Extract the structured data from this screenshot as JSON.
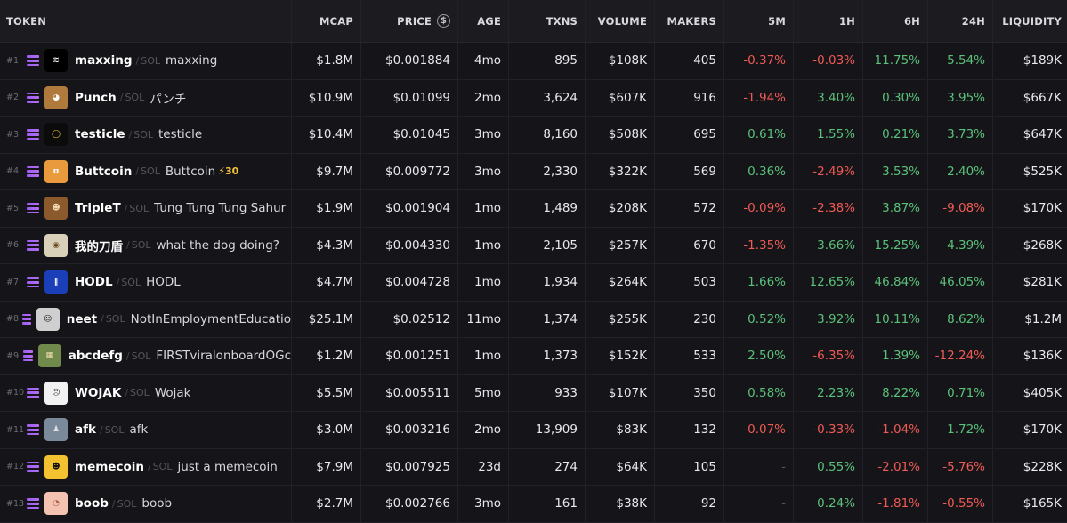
{
  "headers": {
    "token": "TOKEN",
    "mcap": "MCAP",
    "price": "PRICE",
    "price_icon": "$",
    "age": "AGE",
    "txns": "TXNS",
    "volume": "VOLUME",
    "makers": "MAKERS",
    "m5": "5M",
    "h1": "1H",
    "h6": "6H",
    "h24": "24H",
    "liquidity": "LIQUIDITY"
  },
  "chain_label": "SOL",
  "colors": {
    "positive": "#5bc07a",
    "negative": "#ef5a55",
    "boost": "#f5c23b",
    "solana": "#9b5cf6"
  },
  "rows": [
    {
      "rank": "#1",
      "symbol": "maxxing",
      "name": "maxxing",
      "boost": "",
      "logo": "maxxing-logo",
      "mcap": "$1.8M",
      "price": "$0.001884",
      "age": "4mo",
      "txns": "895",
      "volume": "$108K",
      "makers": "405",
      "m5": "-0.37%",
      "h1": "-0.03%",
      "h6": "11.75%",
      "h24": "5.54%",
      "liquidity": "$189K"
    },
    {
      "rank": "#2",
      "symbol": "Punch",
      "name": "パンチ",
      "boost": "",
      "logo": "punch-logo",
      "mcap": "$10.9M",
      "price": "$0.01099",
      "age": "2mo",
      "txns": "3,624",
      "volume": "$607K",
      "makers": "916",
      "m5": "-1.94%",
      "h1": "3.40%",
      "h6": "0.30%",
      "h24": "3.95%",
      "liquidity": "$667K"
    },
    {
      "rank": "#3",
      "symbol": "testicle",
      "name": "testicle",
      "boost": "",
      "logo": "testicle-logo",
      "mcap": "$10.4M",
      "price": "$0.01045",
      "age": "3mo",
      "txns": "8,160",
      "volume": "$508K",
      "makers": "695",
      "m5": "0.61%",
      "h1": "1.55%",
      "h6": "0.21%",
      "h24": "3.73%",
      "liquidity": "$647K"
    },
    {
      "rank": "#4",
      "symbol": "Buttcoin",
      "name": "Buttcoin",
      "boost": "⚡30",
      "logo": "buttcoin-logo",
      "mcap": "$9.7M",
      "price": "$0.009772",
      "age": "3mo",
      "txns": "2,330",
      "volume": "$322K",
      "makers": "569",
      "m5": "0.36%",
      "h1": "-2.49%",
      "h6": "3.53%",
      "h24": "2.40%",
      "liquidity": "$525K"
    },
    {
      "rank": "#5",
      "symbol": "TripleT",
      "name": "Tung Tung Tung Sahur",
      "boost": "",
      "logo": "triplet-logo",
      "mcap": "$1.9M",
      "price": "$0.001904",
      "age": "1mo",
      "txns": "1,489",
      "volume": "$208K",
      "makers": "572",
      "m5": "-0.09%",
      "h1": "-2.38%",
      "h6": "3.87%",
      "h24": "-9.08%",
      "liquidity": "$170K"
    },
    {
      "rank": "#6",
      "symbol": "我的刀盾",
      "name": "what the dog doing?",
      "boost": "",
      "logo": "dog-logo",
      "mcap": "$4.3M",
      "price": "$0.004330",
      "age": "1mo",
      "txns": "2,105",
      "volume": "$257K",
      "makers": "670",
      "m5": "-1.35%",
      "h1": "3.66%",
      "h6": "15.25%",
      "h24": "4.39%",
      "liquidity": "$268K"
    },
    {
      "rank": "#7",
      "symbol": "HODL",
      "name": "HODL",
      "boost": "",
      "logo": "hodl-logo",
      "mcap": "$4.7M",
      "price": "$0.004728",
      "age": "1mo",
      "txns": "1,934",
      "volume": "$264K",
      "makers": "503",
      "m5": "1.66%",
      "h1": "12.65%",
      "h6": "46.84%",
      "h24": "46.05%",
      "liquidity": "$281K"
    },
    {
      "rank": "#8",
      "symbol": "neet",
      "name": "NotInEmploymentEducatio",
      "boost": "",
      "logo": "neet-logo",
      "mcap": "$25.1M",
      "price": "$0.02512",
      "age": "11mo",
      "txns": "1,374",
      "volume": "$255K",
      "makers": "230",
      "m5": "0.52%",
      "h1": "3.92%",
      "h6": "10.11%",
      "h24": "8.62%",
      "liquidity": "$1.2M"
    },
    {
      "rank": "#9",
      "symbol": "abcdefg",
      "name": "FIRSTviralonboardOGc",
      "boost": "",
      "logo": "abcdefg-logo",
      "mcap": "$1.2M",
      "price": "$0.001251",
      "age": "1mo",
      "txns": "1,373",
      "volume": "$152K",
      "makers": "533",
      "m5": "2.50%",
      "h1": "-6.35%",
      "h6": "1.39%",
      "h24": "-12.24%",
      "liquidity": "$136K"
    },
    {
      "rank": "#10",
      "symbol": "WOJAK",
      "name": "Wojak",
      "boost": "",
      "logo": "wojak-logo",
      "mcap": "$5.5M",
      "price": "$0.005511",
      "age": "5mo",
      "txns": "933",
      "volume": "$107K",
      "makers": "350",
      "m5": "0.58%",
      "h1": "2.23%",
      "h6": "8.22%",
      "h24": "0.71%",
      "liquidity": "$405K"
    },
    {
      "rank": "#11",
      "symbol": "afk",
      "name": "afk",
      "boost": "",
      "logo": "afk-logo",
      "mcap": "$3.0M",
      "price": "$0.003216",
      "age": "2mo",
      "txns": "13,909",
      "volume": "$83K",
      "makers": "132",
      "m5": "-0.07%",
      "h1": "-0.33%",
      "h6": "-1.04%",
      "h24": "1.72%",
      "liquidity": "$170K"
    },
    {
      "rank": "#12",
      "symbol": "memecoin",
      "name": "just a memecoin",
      "boost": "",
      "logo": "memecoin-logo",
      "mcap": "$7.9M",
      "price": "$0.007925",
      "age": "23d",
      "txns": "274",
      "volume": "$64K",
      "makers": "105",
      "m5": "-",
      "h1": "0.55%",
      "h6": "-2.01%",
      "h24": "-5.76%",
      "liquidity": "$228K"
    },
    {
      "rank": "#13",
      "symbol": "boob",
      "name": "boob",
      "boost": "",
      "logo": "boob-logo",
      "mcap": "$2.7M",
      "price": "$0.002766",
      "age": "3mo",
      "txns": "161",
      "volume": "$38K",
      "makers": "92",
      "m5": "-",
      "h1": "0.24%",
      "h6": "-1.81%",
      "h24": "-0.55%",
      "liquidity": "$165K"
    }
  ]
}
